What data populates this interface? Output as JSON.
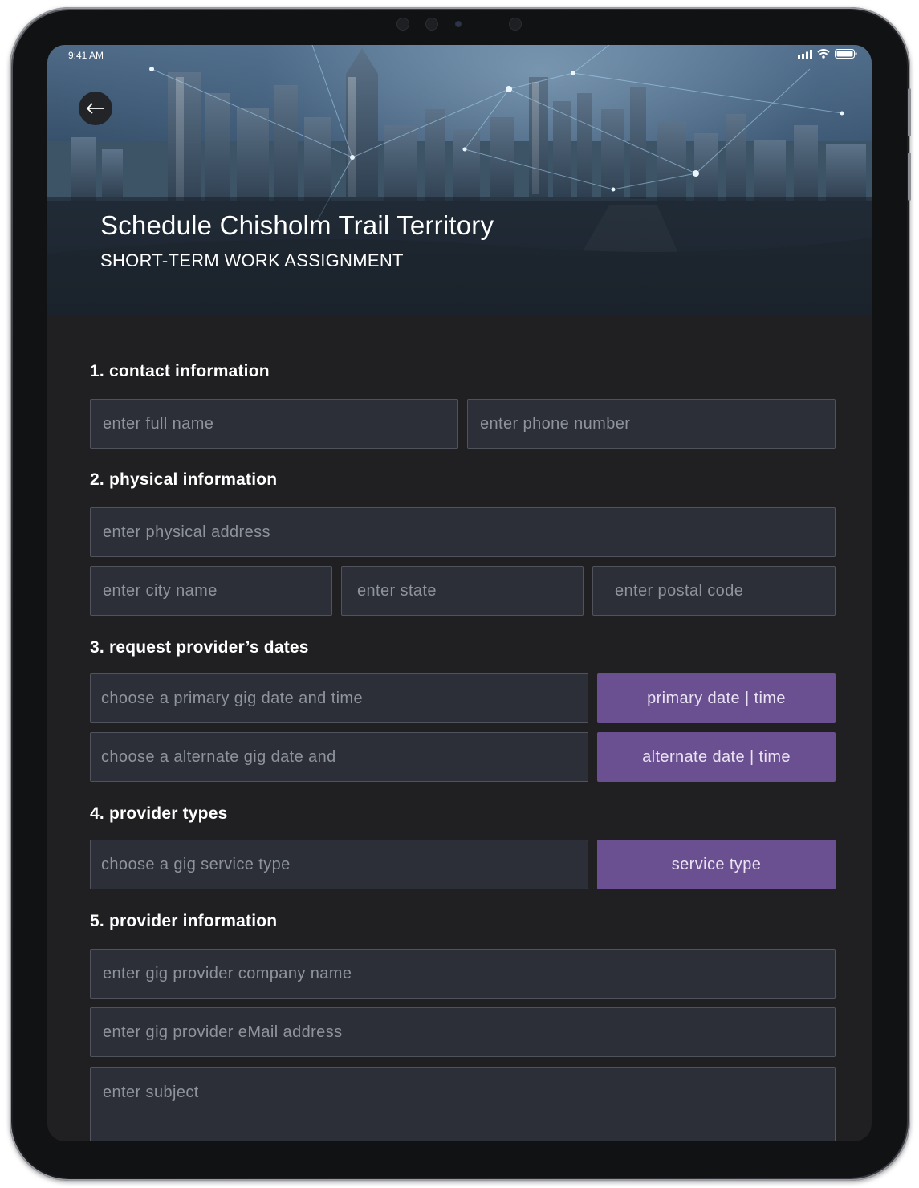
{
  "status_bar": {
    "time": "9:41 AM"
  },
  "header": {
    "title": "Schedule Chisholm Trail Territory",
    "subtitle": "SHORT-TERM WORK ASSIGNMENT",
    "back_icon": "arrow-left-icon"
  },
  "sections": [
    {
      "title": "1. contact information"
    },
    {
      "title": "2. physical information"
    },
    {
      "title": "3. request provider’s dates"
    },
    {
      "title": "4. provider types"
    },
    {
      "title": "5. provider information"
    }
  ],
  "fields": {
    "full_name": "enter full name",
    "phone": "enter phone number",
    "address": "enter physical address",
    "city": "enter city name",
    "state": "enter state",
    "postal": "enter postal code",
    "primary_date": "choose a primary gig date and time",
    "alternate_date": "choose a alternate gig date and",
    "service_type": "choose a gig service type",
    "company": "enter gig provider company name",
    "email": "enter gig provider eMail address",
    "subject": "enter subject"
  },
  "buttons": {
    "primary_date": "primary date | time",
    "alternate_date": "alternate date | time",
    "service_type": "service type"
  },
  "colors": {
    "background": "#202023",
    "field": "#2c2f37",
    "accent": "#6a5090"
  }
}
